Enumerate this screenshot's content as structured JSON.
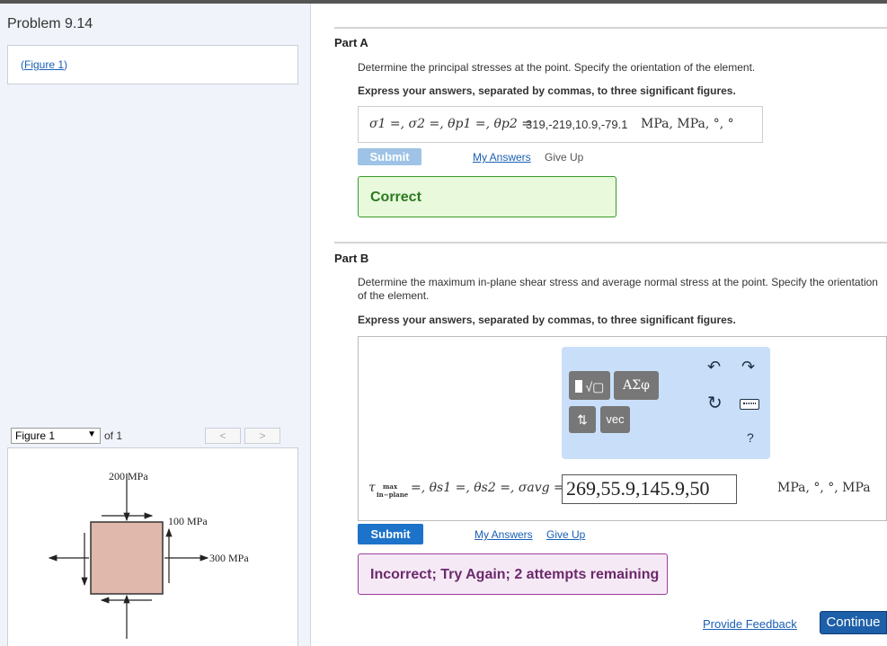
{
  "problem": {
    "title": "Problem 9.14",
    "figure_link": "Figure 1"
  },
  "figure_nav": {
    "selected": "Figure 1",
    "of_label": "of 1",
    "prev": "<",
    "next": ">"
  },
  "figure": {
    "label_top": "200 MPa",
    "label_mid": "100 MPa",
    "label_right": "300 MPa"
  },
  "partA": {
    "label": "Part A",
    "prompt": "Determine the principal stresses at the point. Specify the orientation of the element.",
    "instruction": "Express your answers, separated by commas, to three significant figures.",
    "vars": "σ1 =, σ2 =, θp1 =, θp2 =",
    "answer": "319,-219,10.9,-79.1",
    "units": "MPa, MPa, °, °",
    "submit": "Submit",
    "my_answers": "My Answers",
    "give_up": "Give Up",
    "feedback": "Correct"
  },
  "partB": {
    "label": "Part B",
    "prompt": "Determine the maximum in-plane shear stress and average normal stress at the point. Specify the orientation of the element.",
    "instruction": "Express your answers, separated by commas, to three significant figures.",
    "tau_sub_top": "max",
    "tau_sub_bottom": "in−plane",
    "vars_rest": "=, θs1 =, θs2 =, σavg =",
    "answer": "269,55.9,145.9,50",
    "units": "MPa, °, °, MPa",
    "submit": "Submit",
    "my_answers": "My Answers",
    "give_up": "Give Up",
    "feedback": "Incorrect; Try Again; 2 attempts remaining",
    "toolbar": {
      "greek": "ΑΣφ",
      "vec": "vec",
      "help": "?"
    }
  },
  "footer": {
    "provide_feedback": "Provide Feedback",
    "continue": "Continue"
  },
  "colors": {
    "submit_active": "#1d73c9",
    "submit_disabled": "#9ec3e6",
    "correct_bg": "#e8f9dc",
    "correct_border": "#3a9a2c",
    "correct_text": "#2b7a1f",
    "incorrect_bg": "#f6e9f6",
    "incorrect_border": "#9b3d9b",
    "incorrect_text": "#6b2a6b",
    "stress_element": "#e0b8ac"
  }
}
